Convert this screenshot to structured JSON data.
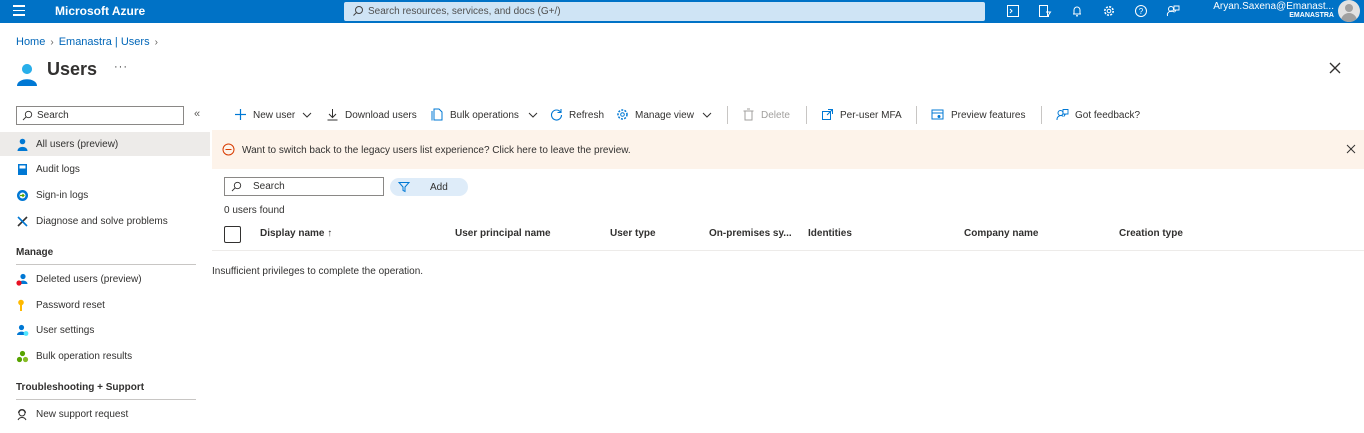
{
  "topbar": {
    "brand": "Microsoft Azure",
    "search_placeholder": "Search resources, services, and docs (G+/)",
    "account_name": "Aryan.Saxena@Emanast...",
    "account_tenant": "EMANASTRA",
    "accent": "#0072c6"
  },
  "breadcrumb": [
    "Home",
    "Emanastra | Users"
  ],
  "page": {
    "title": "Users",
    "more": "···"
  },
  "nav": {
    "search_placeholder": "Search",
    "collapse": "«",
    "items": [
      {
        "label": "All users (preview)",
        "icon": "user-icon"
      },
      {
        "label": "Audit logs",
        "icon": "book-icon"
      },
      {
        "label": "Sign-in logs",
        "icon": "signin-icon"
      },
      {
        "label": "Diagnose and solve problems",
        "icon": "wrench-icon"
      }
    ],
    "manage_title": "Manage",
    "manage_items": [
      {
        "label": "Deleted users (preview)",
        "icon": "deleted-users-icon"
      },
      {
        "label": "Password reset",
        "icon": "key-icon"
      },
      {
        "label": "User settings",
        "icon": "user-settings-icon"
      },
      {
        "label": "Bulk operation results",
        "icon": "bulk-results-icon"
      }
    ],
    "support_title": "Troubleshooting + Support",
    "support_items": [
      {
        "label": "New support request",
        "icon": "support-icon"
      }
    ]
  },
  "commands": {
    "new_user": "New user",
    "download_users": "Download users",
    "bulk_operations": "Bulk operations",
    "refresh": "Refresh",
    "manage_view": "Manage view",
    "delete": "Delete",
    "per_user_mfa": "Per-user MFA",
    "preview_features": "Preview features",
    "got_feedback": "Got feedback?"
  },
  "banner": {
    "text": "Want to switch back to the legacy users list experience? Click here to leave the preview."
  },
  "grid": {
    "search_placeholder": "Search",
    "add_filter": "Add",
    "count": "0 users found",
    "columns": [
      "Display name ↑",
      "User principal name",
      "User type",
      "On-premises sy...",
      "Identities",
      "Company name",
      "Creation type"
    ],
    "message": "Insufficient privileges to complete the operation."
  }
}
